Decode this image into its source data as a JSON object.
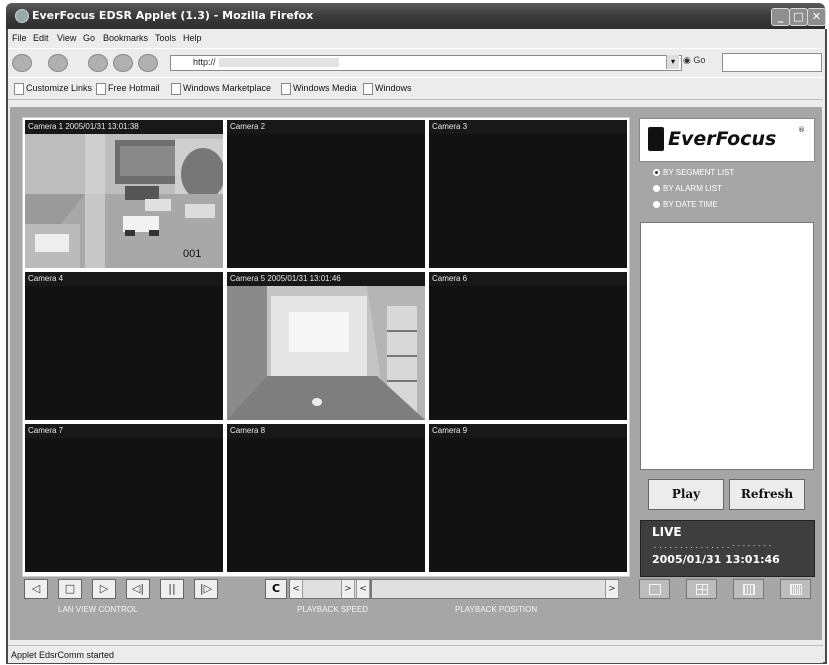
{
  "window": {
    "title": "EverFocus EDSR Applet (1.3) - Mozilla Firefox"
  },
  "menu": [
    "File",
    "Edit",
    "View",
    "Go",
    "Bookmarks",
    "Tools",
    "Help"
  ],
  "nav": {
    "url": "http://",
    "go_label": "Go"
  },
  "links": [
    "Customize Links",
    "Free Hotmail",
    "Windows Marketplace",
    "Windows Media",
    "Windows"
  ],
  "cameras": [
    {
      "label": "Camera 1 2005/01/31 13:01:38",
      "has_image": true,
      "overlay": "001"
    },
    {
      "label": "Camera 2"
    },
    {
      "label": "Camera 3"
    },
    {
      "label": "Camera 4"
    },
    {
      "label": "Camera 5 2005/01/31 13:01:46",
      "has_image": true
    },
    {
      "label": "Camera 6"
    },
    {
      "label": "Camera 7"
    },
    {
      "label": "Camera 8"
    },
    {
      "label": "Camera 9"
    }
  ],
  "sidebar": {
    "brand": "EverFocus",
    "brand_mark": "®",
    "options": [
      {
        "label": "BY SEGMENT LIST",
        "selected": true
      },
      {
        "label": "BY ALARM LIST",
        "selected": false
      },
      {
        "label": "BY DATE TIME",
        "selected": false
      }
    ],
    "play_label": "Play",
    "refresh_label": "Refresh",
    "live_title": "LIVE",
    "live_dots": "...............--------",
    "live_time": "2005/01/31  13:01:46"
  },
  "controls": {
    "lan_view_label": "LAN VIEW CONTROL",
    "playback_speed_label": "PLAYBACK SPEED",
    "playback_position_label": "PLAYBACK POSITION",
    "speed_reset": "C",
    "buttons": [
      "prev",
      "stop",
      "play",
      "step-back",
      "pause",
      "step-forward"
    ],
    "layouts": [
      "single",
      "quad",
      "nine",
      "sixteen"
    ]
  },
  "status": {
    "text": "Applet EdsrComm started"
  }
}
